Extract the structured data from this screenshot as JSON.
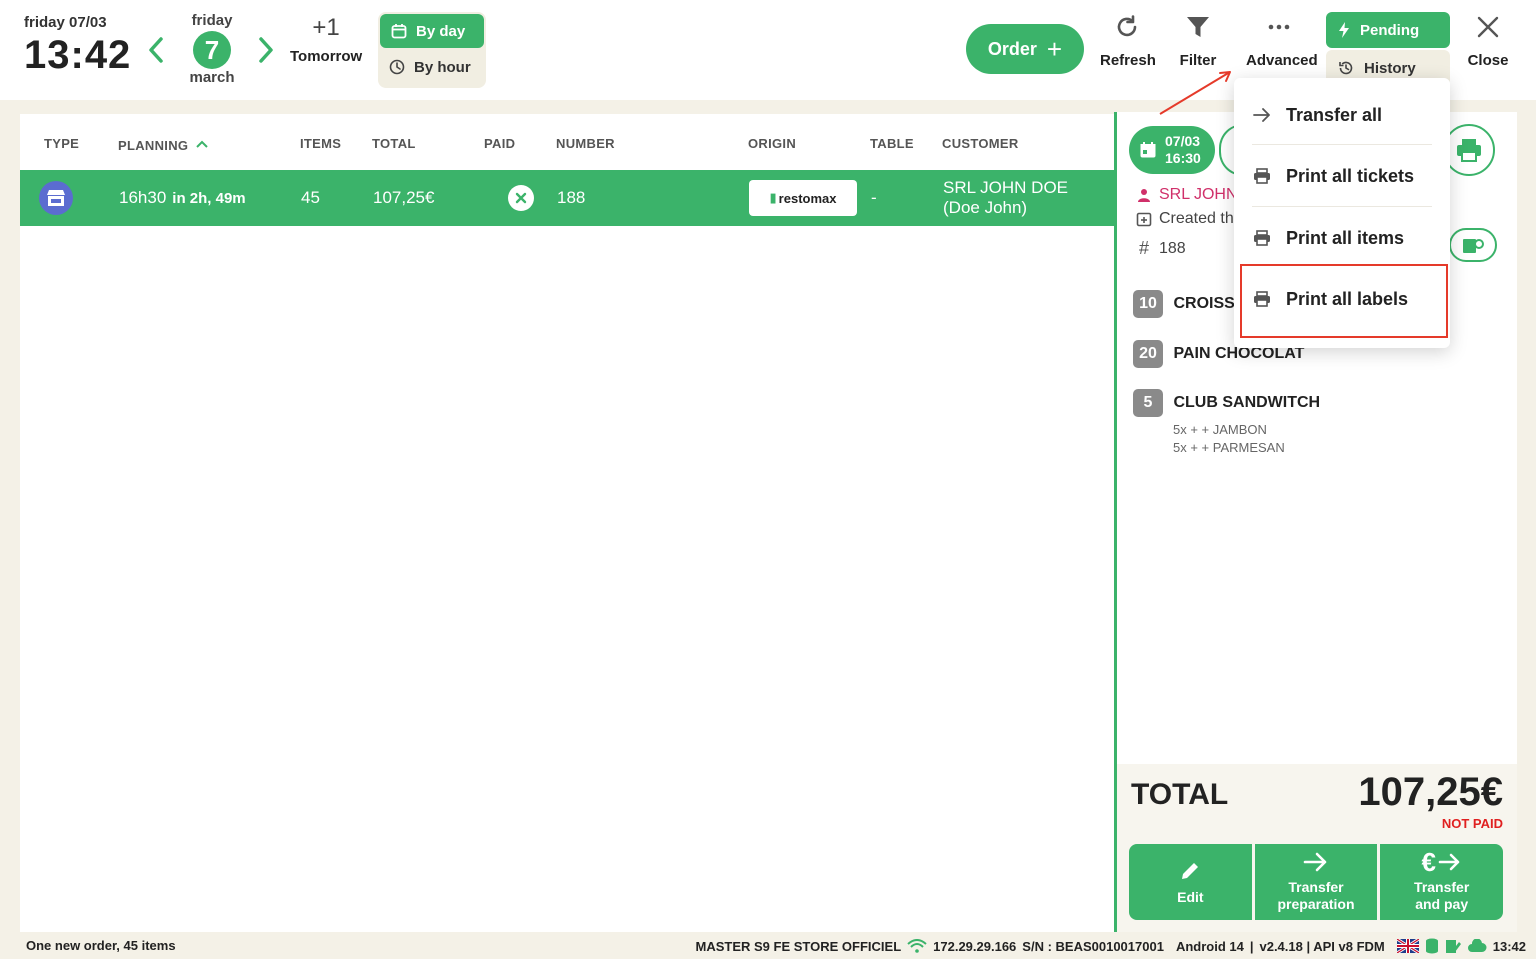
{
  "header": {
    "day_line": "friday 07/03",
    "time": "13:42",
    "selected_day_name": "friday",
    "selected_day_number": "7",
    "selected_month": "march",
    "tomorrow_plus": "+1",
    "tomorrow_label": "Tomorrow",
    "view_by_day": "By day",
    "view_by_hour": "By hour",
    "order_label": "Order",
    "refresh_label": "Refresh",
    "filter_label": "Filter",
    "advanced_label": "Advanced",
    "status_pending": "Pending",
    "status_history": "History",
    "close_label": "Close"
  },
  "table": {
    "columns": [
      "TYPE",
      "PLANNING",
      "ITEMS",
      "TOTAL",
      "PAID",
      "NUMBER",
      "ORIGIN",
      "TABLE",
      "CUSTOMER"
    ],
    "rows": [
      {
        "planning_time": "16h30",
        "planning_rel": "in 2h, 49m",
        "items": "45",
        "total": "107,25€",
        "number": "188",
        "origin": "restomax",
        "table": "-",
        "customer": "SRL JOHN DOE (Doe John)"
      }
    ]
  },
  "detail": {
    "date": "07/03",
    "time": "16:30",
    "customer": "SRL JOHN DC",
    "created": "Created the",
    "number": "188",
    "items": [
      {
        "qty": "10",
        "name": "CROISSAN"
      },
      {
        "qty": "20",
        "name": "PAIN CHOCOLAT"
      },
      {
        "qty": "5",
        "name": "CLUB SANDWITCH",
        "subs": [
          "5x + + JAMBON",
          "5x + + PARMESAN"
        ]
      }
    ],
    "total_label": "TOTAL",
    "total_value": "107,25€",
    "not_paid": "NOT PAID",
    "actions": {
      "edit": "Edit",
      "transfer_prep_1": "Transfer",
      "transfer_prep_2": "preparation",
      "transfer_pay_1": "Transfer",
      "transfer_pay_2": "and pay"
    }
  },
  "dropdown": {
    "items": [
      "Transfer all",
      "Print all tickets",
      "Print all items",
      "Print all labels"
    ]
  },
  "footer": {
    "left": "One new order, 45 items",
    "store": "MASTER S9 FE STORE OFFICIEL",
    "ip": "172.29.29.166",
    "serial": "S/N : BEAS0010017001",
    "android": "Android 14",
    "version": "v2.4.18 | API v8 FDM",
    "time": "13:42"
  },
  "colors": {
    "accent": "#3bb36a",
    "alert": "#e02020",
    "highlight": "#e53a2a",
    "type_icon": "#5b6cd0"
  }
}
